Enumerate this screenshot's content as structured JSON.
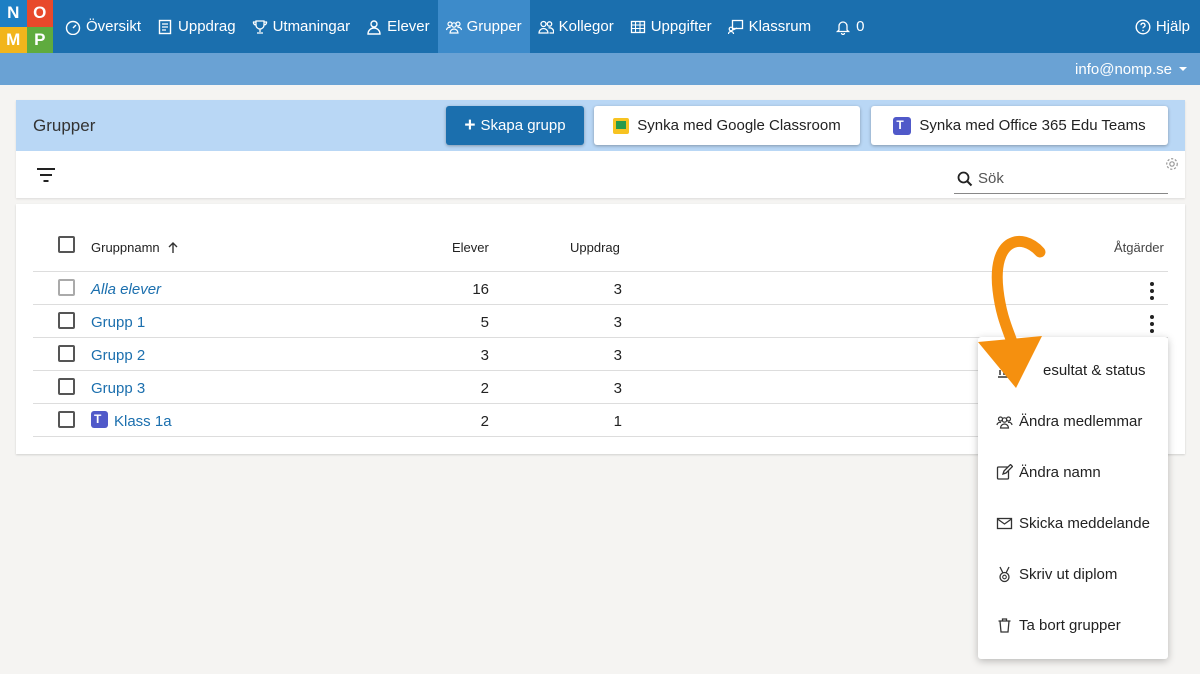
{
  "logo": {
    "letters": [
      "N",
      "O",
      "M",
      "P"
    ]
  },
  "nav": {
    "items": [
      {
        "label": "Översikt",
        "icon": "dashboard-icon"
      },
      {
        "label": "Uppdrag",
        "icon": "book-icon"
      },
      {
        "label": "Utmaningar",
        "icon": "trophy-icon"
      },
      {
        "label": "Elever",
        "icon": "user-icon"
      },
      {
        "label": "Grupper",
        "icon": "users-icon",
        "active": true
      },
      {
        "label": "Kollegor",
        "icon": "users-icon"
      },
      {
        "label": "Uppgifter",
        "icon": "table-icon"
      },
      {
        "label": "Klassrum",
        "icon": "classroom-icon"
      }
    ],
    "notifications": "0",
    "help": "Hjälp",
    "account": "info@nomp.se"
  },
  "header": {
    "title": "Grupper",
    "create_button": "Skapa grupp",
    "google_button": "Synka med Google Classroom",
    "teams_button": "Synka med Office 365 Edu Teams",
    "search_placeholder": "Sök"
  },
  "table": {
    "columns": {
      "name": "Gruppnamn",
      "students": "Elever",
      "assignments": "Uppdrag",
      "actions": "Åtgärder"
    },
    "rows": [
      {
        "name": "Alla elever",
        "students": "16",
        "assignments": "3",
        "italic": true
      },
      {
        "name": "Grupp 1",
        "students": "5",
        "assignments": "3"
      },
      {
        "name": "Grupp 2",
        "students": "3",
        "assignments": "3"
      },
      {
        "name": "Grupp 3",
        "students": "2",
        "assignments": "3"
      },
      {
        "name": "Klass 1a",
        "students": "2",
        "assignments": "1",
        "teams": true
      }
    ]
  },
  "menu": {
    "items": [
      {
        "label": "Resultat & status",
        "visible_text": "esultat & status"
      },
      {
        "label": "Ändra medlemmar"
      },
      {
        "label": "Ändra namn"
      },
      {
        "label": "Skicka meddelande"
      },
      {
        "label": "Skriv ut diplom"
      },
      {
        "label": "Ta bort grupper"
      }
    ]
  },
  "colors": {
    "nav": "#1b6fae",
    "accent": "#f5900f",
    "header_bg": "#b9d7f5"
  }
}
